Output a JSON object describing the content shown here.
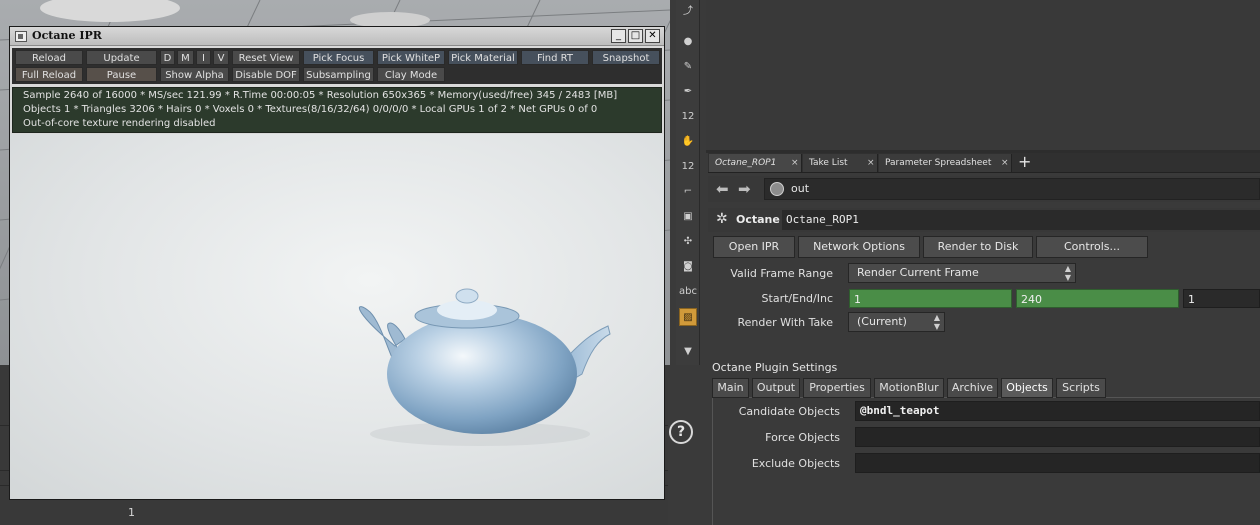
{
  "ipr_window": {
    "title": "Octane IPR",
    "controls": {
      "minimize": "_",
      "maximize": "□",
      "close": "✕"
    },
    "toolbar_row1": [
      "Reload",
      "Update",
      "D",
      "M",
      "I",
      "V",
      "Reset View",
      "Pick Focus",
      "Pick WhiteP",
      "Pick Material",
      "Find RT",
      "Snapshot"
    ],
    "toolbar_row2": [
      "Full Reload",
      "Pause",
      "Show Alpha",
      "Disable DOF",
      "Subsampling",
      "Clay Mode"
    ],
    "status": {
      "line1": "Sample 2640 of 16000 * MS/sec 121.99 * R.Time 00:00:05 * Resolution 650x365 * Memory(used/free) 345 / 2483 [MB]",
      "line2": "Objects 1 * Triangles 3206 * Hairs 0 * Voxels 0 * Textures(8/16/32/64) 0/0/0/0 * Local GPUs 1 of 2 * Net GPUs 0 of 0",
      "line3": "Out-of-core texture rendering disabled"
    }
  },
  "toolstrip": {
    "numeric_label_1": "12",
    "numeric_label_2": "12",
    "text_tool_label": "abc",
    "help_glyph": "?"
  },
  "viewport_bottom": {
    "frame_number": "1"
  },
  "param_pane": {
    "tabs": [
      {
        "label": "Octane_ROP1",
        "close": "×"
      },
      {
        "label": "Take List",
        "close": "×"
      },
      {
        "label": "Parameter Spreadsheet",
        "close": "×"
      }
    ],
    "add_tab": "+",
    "nav_back": "⬅",
    "nav_forward": "➡",
    "path": "out",
    "node_type": "Octane",
    "node_name": "Octane_ROP1",
    "buttons": [
      "Open IPR",
      "Network Options",
      "Render to Disk",
      "Controls..."
    ],
    "valid_frame_range": {
      "label": "Valid Frame Range",
      "value": "Render Current Frame"
    },
    "start_end_inc": {
      "label": "Start/End/Inc",
      "start": "1",
      "end": "240",
      "inc": "1"
    },
    "render_with_take": {
      "label": "Render With Take",
      "value": "(Current)"
    },
    "section_title": "Octane Plugin Settings",
    "subtabs": [
      "Main",
      "Output",
      "Properties",
      "MotionBlur",
      "Archive",
      "Objects",
      "Scripts"
    ],
    "active_subtab": "Objects",
    "candidate_objects": {
      "label": "Candidate Objects",
      "value": "@bndl_teapot"
    },
    "force_objects": {
      "label": "Force Objects",
      "value": ""
    },
    "exclude_objects": {
      "label": "Exclude Objects",
      "value": ""
    }
  },
  "colors": {
    "accent_green": "#4a8d47",
    "status_bg": "#2c3a2c",
    "active_tool": "#d19a3a",
    "teapot": "#a9c3da"
  }
}
